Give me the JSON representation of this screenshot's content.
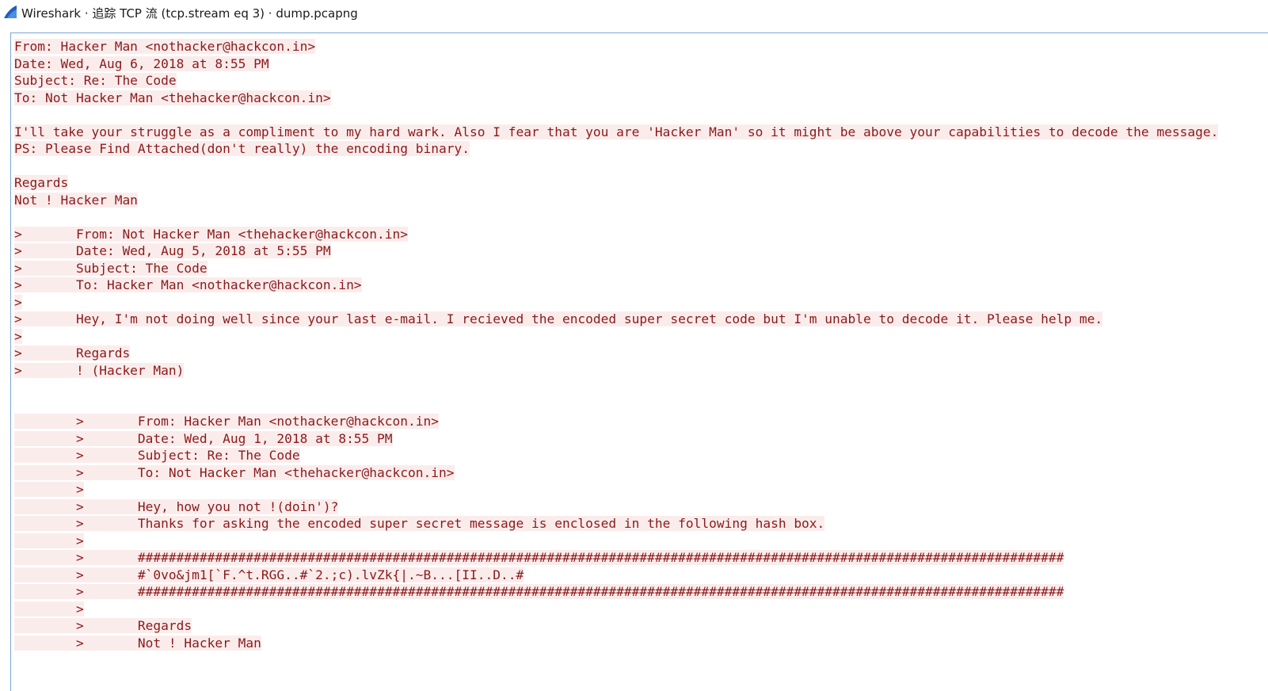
{
  "window": {
    "title": "Wireshark · 追踪 TCP 流 (tcp.stream eq 3) · dump.pcapng",
    "icon": "wireshark-fin-icon",
    "colors": {
      "text": "#8b1a1a",
      "highlight": "#fbecec",
      "frame": "#7aa6d8",
      "icon": "#1f5fbf"
    }
  },
  "stream": {
    "lines": [
      "From: Hacker Man <nothacker@hackcon.in>",
      "Date: Wed, Aug 6, 2018 at 8:55 PM",
      "Subject: Re: The Code",
      "To: Not Hacker Man <thehacker@hackcon.in>",
      "",
      "I'll take your struggle as a compliment to my hard wark. Also I fear that you are 'Hacker Man' so it might be above your capabilities to decode the message.",
      "PS: Please Find Attached(don't really) the encoding binary.",
      "",
      "Regards",
      "Not ! Hacker Man",
      "",
      ">       From: Not Hacker Man <thehacker@hackcon.in>",
      ">       Date: Wed, Aug 5, 2018 at 5:55 PM",
      ">       Subject: The Code",
      ">       To: Hacker Man <nothacker@hackcon.in>",
      ">",
      ">       Hey, I'm not doing well since your last e-mail. I recieved the encoded super secret code but I'm unable to decode it. Please help me.",
      ">",
      ">       Regards",
      ">       ! (Hacker Man)",
      "",
      "",
      "        >       From: Hacker Man <nothacker@hackcon.in>",
      "        >       Date: Wed, Aug 1, 2018 at 8:55 PM",
      "        >       Subject: Re: The Code",
      "        >       To: Not Hacker Man <thehacker@hackcon.in>",
      "        >",
      "        >       Hey, how you not !(doin')?",
      "        >       Thanks for asking the encoded super secret message is enclosed in the following hash box.",
      "        >",
      "        >       ########################################################################################################################",
      "        >       #`0vo&jm1[`F.^t.RGG..#`2.;c).lvZk{|.~B...[II..D..#",
      "        >       ########################################################################################################################",
      "        >",
      "        >       Regards",
      "        >       Not ! Hacker Man"
    ]
  }
}
